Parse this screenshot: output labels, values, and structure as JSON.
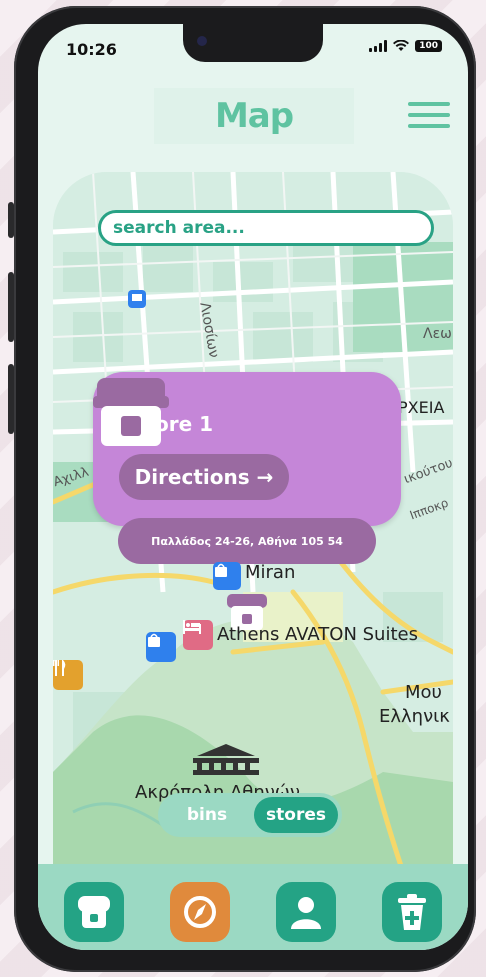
{
  "status": {
    "time": "10:26",
    "battery": "100"
  },
  "header": {
    "title": "Map"
  },
  "search": {
    "placeholder": "search area..."
  },
  "store_card": {
    "name": "Store 1",
    "directions_label": "Directions →",
    "address": "Παλλάδος 24-26, Αθήνα 105 54"
  },
  "map_labels": {
    "miran": "Miran",
    "avaton": "Athens AVATON Suites",
    "mou": "Μου",
    "ellinik": "Ελληνικ",
    "akropoli": "Ακρόπολη Αθηνών",
    "leo": "Λεω",
    "archeia": "ΡΧΕΙΑ",
    "akoutou": "ικούτου",
    "ippokr": "Ιπποκρ",
    "axill": "Αχιλλ",
    "loisio": "Λιοσίων"
  },
  "toggle": {
    "bins": "bins",
    "stores": "stores",
    "selected": "stores"
  },
  "nav": [
    {
      "name": "home",
      "icon": "store-home-icon",
      "color": "#24a385"
    },
    {
      "name": "compass",
      "icon": "compass-icon",
      "color": "#e08a3c"
    },
    {
      "name": "profile",
      "icon": "user-icon",
      "color": "#24a385"
    },
    {
      "name": "bin",
      "icon": "recycle-bin-icon",
      "color": "#24a385"
    }
  ],
  "colors": {
    "accent": "#5fc3a1",
    "dark_accent": "#24a385",
    "store_purple": "#c586d8",
    "store_dark": "#9a6aa1"
  }
}
